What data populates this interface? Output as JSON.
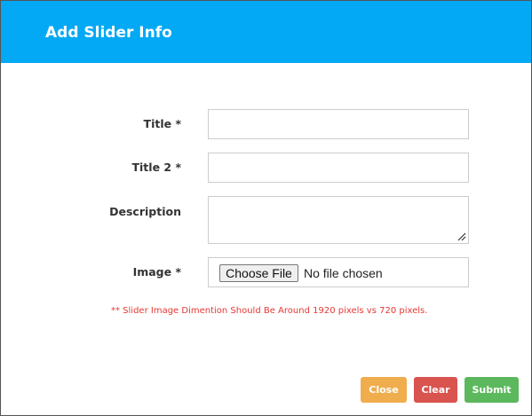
{
  "modal": {
    "title": "Add Slider Info"
  },
  "form": {
    "title_label": "Title *",
    "title_value": "",
    "title2_label": "Title 2 *",
    "title2_value": "",
    "description_label": "Description",
    "description_value": "",
    "image_label": "Image *",
    "choose_file_label": "Choose File",
    "file_status": "No file chosen",
    "dimension_note": "** Slider Image Dimention Should Be Around 1920 pixels vs 720 pixels."
  },
  "buttons": {
    "close_label": "Close",
    "clear_label": "Clear",
    "submit_label": "Submit"
  },
  "colors": {
    "header": "#03a9f4",
    "close": "#f0ad4e",
    "clear": "#d9534f",
    "submit": "#5cb85c",
    "note": "#e53935"
  },
  "icons": {
    "textarea_resize": "resize-handle-icon"
  }
}
